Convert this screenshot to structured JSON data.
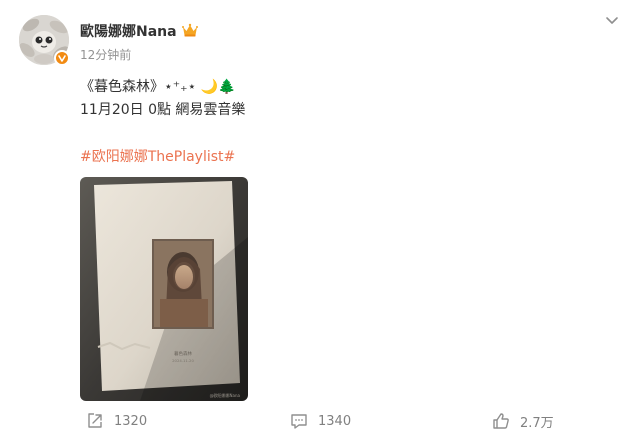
{
  "post": {
    "author": {
      "name": "歐陽娜娜Nana"
    },
    "time": "12分钟前",
    "text_line1": "《暮色森林》⋆⁺₊⋆ 🌙🌲",
    "text_line2": "11月20日 0點 網易雲音樂",
    "hashtag": "#欧阳娜娜ThePlaylist#",
    "image": {
      "card_title": "暮色森林",
      "card_date": "2024.11.20",
      "watermark": "@欧阳娜娜Nana"
    }
  },
  "actions": {
    "repost_count": "1320",
    "comment_count": "1340",
    "like_count": "2.7万"
  },
  "colors": {
    "hashtag": "#eb7350",
    "badge": "#f28b13",
    "crown": "#f5a623",
    "muted": "#939393"
  },
  "icons": {
    "more": "chevron-down-icon",
    "repost": "share-icon",
    "comment": "comment-icon",
    "like": "thumbs-up-icon"
  }
}
